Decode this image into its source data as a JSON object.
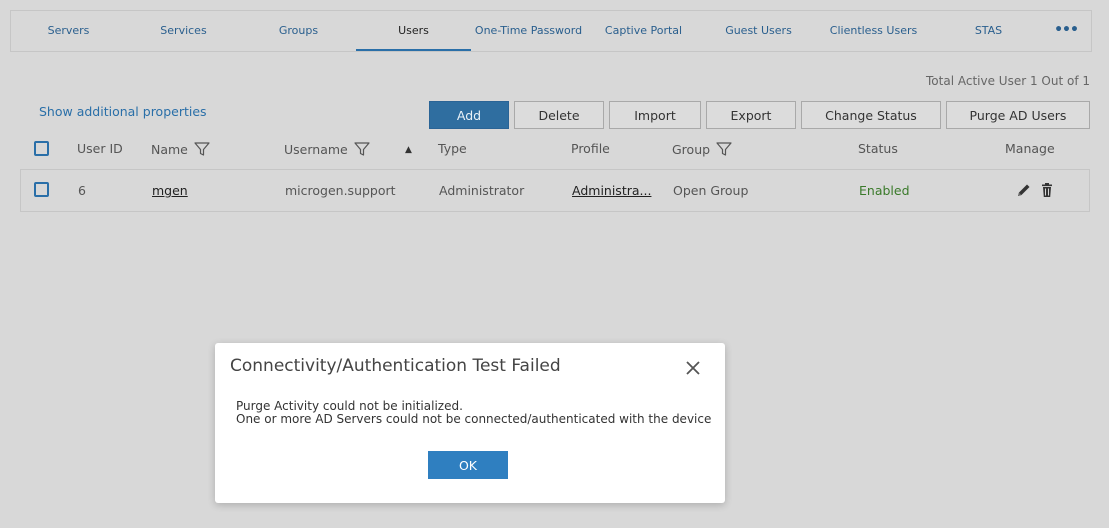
{
  "tabs": [
    {
      "label": "Servers"
    },
    {
      "label": "Services"
    },
    {
      "label": "Groups"
    },
    {
      "label": "Users"
    },
    {
      "label": "One-Time Password"
    },
    {
      "label": "Captive Portal"
    },
    {
      "label": "Guest Users"
    },
    {
      "label": "Clientless Users"
    },
    {
      "label": "STAS"
    },
    {
      "label": "•••"
    }
  ],
  "active_tab": "Users",
  "total_label": "Total Active User 1 Out of 1",
  "show_additional": "Show additional properties",
  "toolbar": {
    "add": "Add",
    "delete": "Delete",
    "import": "Import",
    "export": "Export",
    "change_status": "Change Status",
    "purge_ad": "Purge AD Users"
  },
  "columns": {
    "user_id": "User ID",
    "name": "Name",
    "username": "Username",
    "type": "Type",
    "profile": "Profile",
    "group": "Group",
    "status": "Status",
    "manage": "Manage"
  },
  "rows": [
    {
      "user_id": "6",
      "name": "mgen",
      "username": "microgen.support",
      "type": "Administrator",
      "profile": "Administra...",
      "group": "Open Group",
      "status": "Enabled"
    }
  ],
  "dialog": {
    "title": "Connectivity/Authentication Test Failed",
    "message_line1": "Purge Activity could not be initialized.",
    "message_line2": "One or more AD Servers could not be connected/authenticated with the device",
    "ok": "OK"
  },
  "colors": {
    "accent": "#2f6ea0",
    "ok_button": "#2f7fc0",
    "status_enabled": "#3a7a2a",
    "link": "#2a6fa8"
  },
  "icons": [
    "filter-icon",
    "sort-asc-icon",
    "edit-icon",
    "delete-icon",
    "close-icon",
    "more-icon"
  ]
}
